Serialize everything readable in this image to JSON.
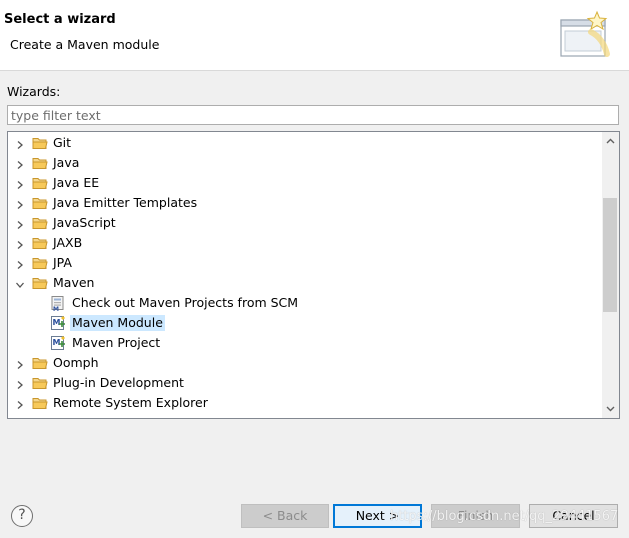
{
  "header": {
    "title": "Select a wizard",
    "description": "Create a Maven module"
  },
  "wizards_label": "Wizards:",
  "filter": {
    "placeholder": "type filter text",
    "value": ""
  },
  "tree": [
    {
      "label": "Git",
      "kind": "folder",
      "expanded": false,
      "level": 0
    },
    {
      "label": "Java",
      "kind": "folder",
      "expanded": false,
      "level": 0
    },
    {
      "label": "Java EE",
      "kind": "folder",
      "expanded": false,
      "level": 0
    },
    {
      "label": "Java Emitter Templates",
      "kind": "folder",
      "expanded": false,
      "level": 0
    },
    {
      "label": "JavaScript",
      "kind": "folder",
      "expanded": false,
      "level": 0
    },
    {
      "label": "JAXB",
      "kind": "folder",
      "expanded": false,
      "level": 0
    },
    {
      "label": "JPA",
      "kind": "folder",
      "expanded": false,
      "level": 0
    },
    {
      "label": "Maven",
      "kind": "folder",
      "expanded": true,
      "level": 0
    },
    {
      "label": "Check out Maven Projects from SCM",
      "kind": "maven-scm",
      "level": 1
    },
    {
      "label": "Maven Module",
      "kind": "maven",
      "level": 1,
      "selected": true
    },
    {
      "label": "Maven Project",
      "kind": "maven",
      "level": 1
    },
    {
      "label": "Oomph",
      "kind": "folder",
      "expanded": false,
      "level": 0
    },
    {
      "label": "Plug-in Development",
      "kind": "folder",
      "expanded": false,
      "level": 0
    },
    {
      "label": "Remote System Explorer",
      "kind": "folder",
      "expanded": false,
      "level": 0
    }
  ],
  "buttons": {
    "help": "?",
    "back": "< Back",
    "next": "Next >",
    "finish": "Finish",
    "cancel": "Cancel"
  },
  "watermark": "https://blog.csdn.net/qq_29441567",
  "colors": {
    "selection": "#cce8ff",
    "folder": "#e8b84a",
    "default_button_border": "#0078d7"
  }
}
